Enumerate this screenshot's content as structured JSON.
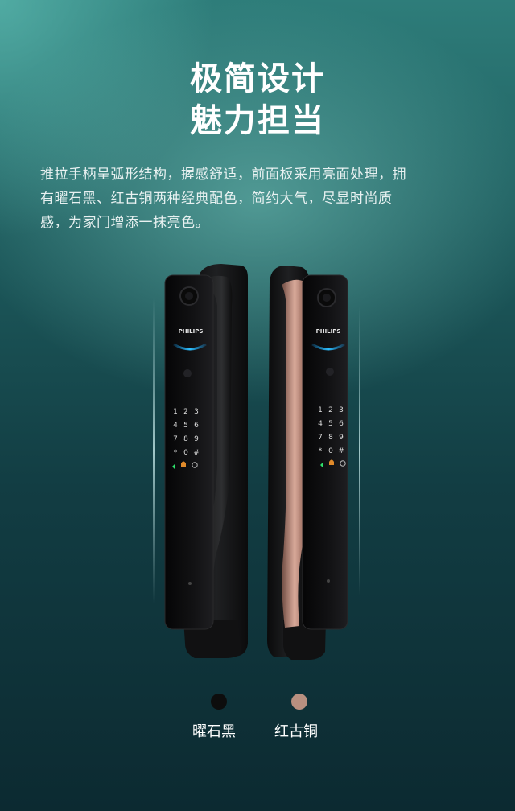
{
  "headline": {
    "line1": "极简设计",
    "line2": "魅力担当"
  },
  "description": {
    "line1": "推拉手柄呈弧形结构，握感舒适，前面板采用亮面处理，拥",
    "line2": "有曜石黑、红古铜两种经典配色，简约大气，尽显时尚质",
    "line3": "感，为家门增添一抹亮色。"
  },
  "product": {
    "brand": "PHILIPS",
    "keypad": [
      "1",
      "2",
      "3",
      "4",
      "5",
      "6",
      "7",
      "8",
      "9",
      "*",
      "0",
      "#"
    ]
  },
  "colors": [
    {
      "label": "曜石黑",
      "hex": "#0d0d0d"
    },
    {
      "label": "红古铜",
      "hex": "#b89080"
    }
  ]
}
